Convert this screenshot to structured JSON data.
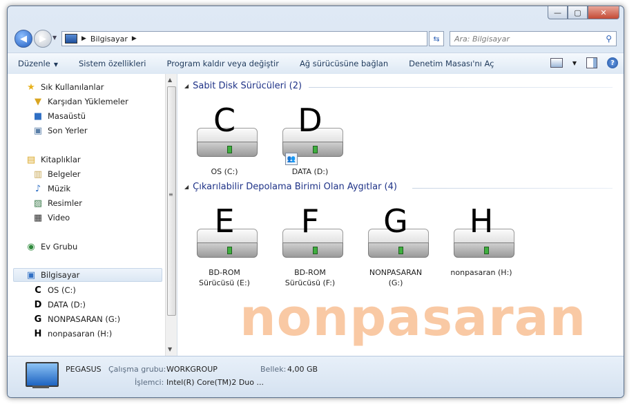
{
  "window": {
    "caption_min": "—",
    "caption_max": "▢",
    "caption_close": "✕"
  },
  "navbar": {
    "breadcrumb": "Bilgisayar",
    "search_placeholder": "Ara: Bilgisayar"
  },
  "toolbar": {
    "organize": "Düzenle",
    "system_properties": "Sistem özellikleri",
    "uninstall": "Program kaldır veya değiştir",
    "map_drive": "Ağ sürücüsüne bağlan",
    "control_panel": "Denetim Masası'nı Aç"
  },
  "sidebar": {
    "favorites": "Sık Kullanılanlar",
    "downloads": "Karşıdan Yüklemeler",
    "desktop": "Masaüstü",
    "recent": "Son Yerler",
    "libraries": "Kitaplıklar",
    "documents": "Belgeler",
    "music": "Müzik",
    "pictures": "Resimler",
    "video": "Video",
    "homegroup": "Ev Grubu",
    "computer": "Bilgisayar",
    "drive_c": "OS (C:)",
    "drive_d": "DATA (D:)",
    "drive_g": "NONPASARAN (G:)",
    "drive_h": "nonpasaran (H:)",
    "letter_c": "C",
    "letter_d": "D",
    "letter_g": "G",
    "letter_h": "H"
  },
  "groups": {
    "hard_disks": "Sabit Disk Sürücüleri (2)",
    "removable": "Çıkarılabilir Depolama Birimi Olan Aygıtlar (4)"
  },
  "drives": {
    "c": {
      "letter": "C",
      "label": "OS (C:)"
    },
    "d": {
      "letter": "D",
      "label": "DATA (D:)"
    },
    "e": {
      "letter": "E",
      "label1": "BD-ROM",
      "label2": "Sürücüsü (E:)"
    },
    "f": {
      "letter": "F",
      "label1": "BD-ROM",
      "label2": "Sürücüsü (F:)"
    },
    "g": {
      "letter": "G",
      "label1": "NONPASARAN",
      "label2": "(G:)"
    },
    "h": {
      "letter": "H",
      "label": "nonpasaran (H:)"
    }
  },
  "watermark": "nonpasaran",
  "details": {
    "name": "PEGASUS",
    "workgroup_key": "Çalışma grubu:",
    "workgroup_val": "WORKGROUP",
    "memory_key": "Bellek:",
    "memory_val": "4,00 GB",
    "cpu_key": "İşlemci:",
    "cpu_val": "Intel(R) Core(TM)2 Duo ..."
  },
  "colors": {
    "accent": "#1e3287",
    "watermark": "#f9c9a4",
    "toolbar_text": "#1e395b"
  }
}
